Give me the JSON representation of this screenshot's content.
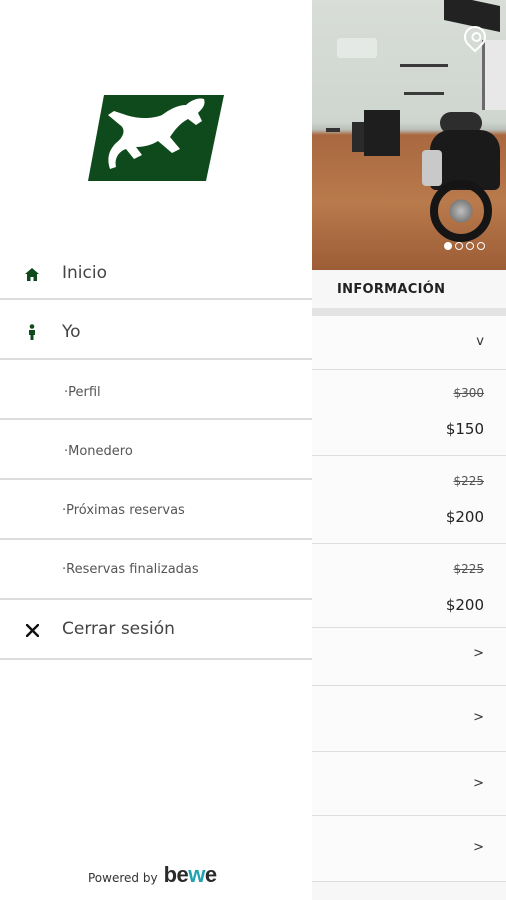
{
  "drawer": {
    "menu": [
      {
        "label": "Inicio",
        "icon": "home-icon"
      },
      {
        "label": "Yo",
        "icon": "person-icon"
      },
      {
        "label": "·Perfil"
      },
      {
        "label": "·Monedero"
      },
      {
        "label": "·Próximas reservas"
      },
      {
        "label": "·Reservas finalizadas"
      },
      {
        "label": "Cerrar sesión",
        "icon": "close-icon"
      }
    ],
    "powered_by": "Powered by",
    "bewe_logo": "bewe"
  },
  "background_page": {
    "section_title": "INFORMACIÓN",
    "photo_dots": 4,
    "rows": [
      {
        "chevron": "v"
      },
      {
        "old_price": "$300",
        "price": "$150"
      },
      {
        "old_price": "$225",
        "price": "$200"
      },
      {
        "old_price": "$225",
        "price": "$200"
      },
      {
        "chevron": ">"
      },
      {
        "chevron": ">"
      },
      {
        "chevron": ">"
      },
      {
        "chevron": ">"
      }
    ]
  },
  "colors": {
    "brand_green": "#0e4a1c",
    "bewe_teal": "#1fa3b0"
  }
}
